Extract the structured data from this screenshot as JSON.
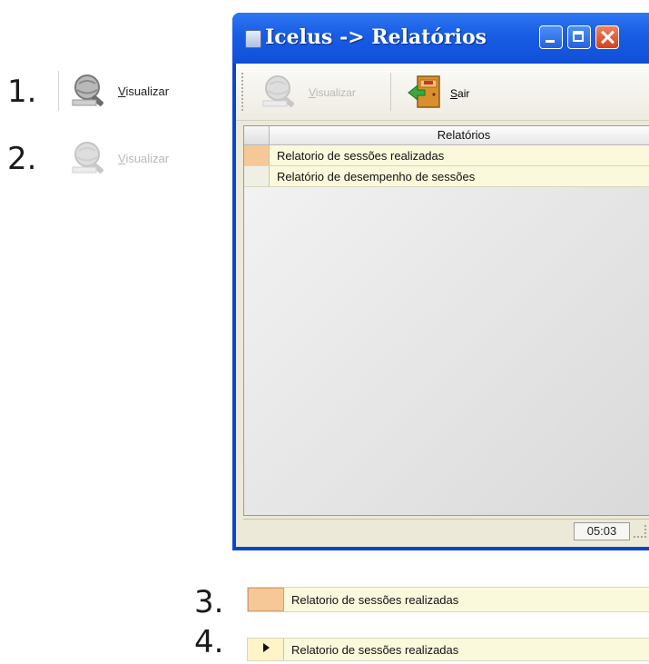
{
  "steps": [
    "1.",
    "2.",
    "3.",
    "4."
  ],
  "example_buttons": {
    "enabled": {
      "label_prefix": "",
      "label_u": "V",
      "label_rest": "isualizar"
    },
    "disabled": {
      "label_prefix": "",
      "label_u": "V",
      "label_rest": "isualizar"
    }
  },
  "window": {
    "title": "Icelus -> Relatórios",
    "toolbar": {
      "visualizar": {
        "label_u": "V",
        "label_rest": "isualizar"
      },
      "sair": {
        "label_u": "S",
        "label_rest": "air"
      }
    },
    "grid": {
      "header": "Relatórios",
      "rows": [
        "Relatorio de sessões realizadas",
        "Relatório de desempenho de sessões"
      ]
    },
    "status": {
      "time": "05:03"
    }
  },
  "samples": {
    "row3": "Relatorio de sessões realizadas",
    "row4": "Relatorio de sessões realizadas"
  },
  "colors": {
    "title_bar": "#1a5ee6",
    "row_active": "#f7c897",
    "row_bg": "#fbf9dc"
  }
}
